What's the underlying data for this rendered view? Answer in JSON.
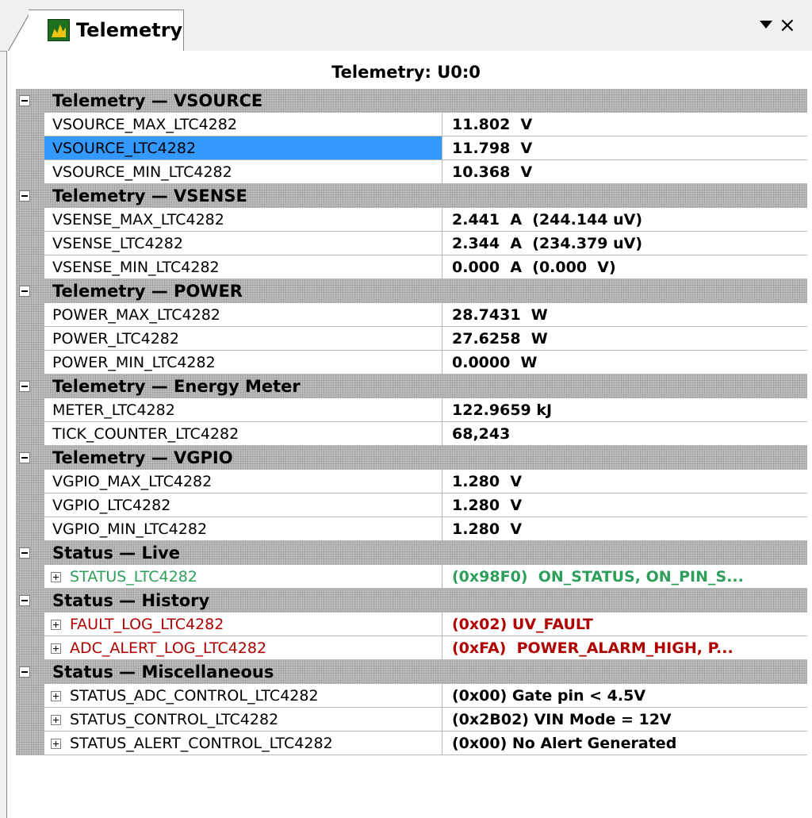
{
  "tab": {
    "label": "Telemetry",
    "close": "×"
  },
  "panel_title": "Telemetry: U0:0",
  "groups": [
    {
      "label": "Telemetry — VSOURCE",
      "rows": [
        {
          "name": "VSOURCE_MAX_LTC4282",
          "value": "11.802  V"
        },
        {
          "name": "VSOURCE_LTC4282",
          "value": "11.798  V",
          "selected": true
        },
        {
          "name": "VSOURCE_MIN_LTC4282",
          "value": "10.368  V"
        }
      ]
    },
    {
      "label": "Telemetry — VSENSE",
      "rows": [
        {
          "name": "VSENSE_MAX_LTC4282",
          "value": "2.441  A  (244.144 uV)"
        },
        {
          "name": "VSENSE_LTC4282",
          "value": "2.344  A  (234.379 uV)"
        },
        {
          "name": "VSENSE_MIN_LTC4282",
          "value": "0.000  A  (0.000  V)"
        }
      ]
    },
    {
      "label": "Telemetry — POWER",
      "rows": [
        {
          "name": "POWER_MAX_LTC4282",
          "value": "28.7431  W"
        },
        {
          "name": "POWER_LTC4282",
          "value": "27.6258  W"
        },
        {
          "name": "POWER_MIN_LTC4282",
          "value": "0.0000  W"
        }
      ]
    },
    {
      "label": "Telemetry — Energy Meter",
      "rows": [
        {
          "name": "METER_LTC4282",
          "value": "122.9659 kJ"
        },
        {
          "name": "TICK_COUNTER_LTC4282",
          "value": "68,243"
        }
      ]
    },
    {
      "label": "Telemetry — VGPIO",
      "rows": [
        {
          "name": "VGPIO_MAX_LTC4282",
          "value": "1.280  V"
        },
        {
          "name": "VGPIO_LTC4282",
          "value": "1.280  V"
        },
        {
          "name": "VGPIO_MIN_LTC4282",
          "value": "1.280  V"
        }
      ]
    },
    {
      "label": "Status — Live",
      "rows": [
        {
          "name": "STATUS_LTC4282",
          "value": "(0x98F0)  ON_STATUS, ON_PIN_S...",
          "expandable": true,
          "color": "green"
        }
      ]
    },
    {
      "label": "Status — History",
      "rows": [
        {
          "name": "FAULT_LOG_LTC4282",
          "value": "(0x02) UV_FAULT",
          "expandable": true,
          "color": "red"
        },
        {
          "name": "ADC_ALERT_LOG_LTC4282",
          "value": "(0xFA)  POWER_ALARM_HIGH, P...",
          "expandable": true,
          "color": "red"
        }
      ]
    },
    {
      "label": "Status — Miscellaneous",
      "rows": [
        {
          "name": "STATUS_ADC_CONTROL_LTC4282",
          "value": "(0x00) Gate pin < 4.5V",
          "expandable": true
        },
        {
          "name": "STATUS_CONTROL_LTC4282",
          "value": "(0x2B02) VIN Mode = 12V",
          "expandable": true
        },
        {
          "name": "STATUS_ALERT_CONTROL_LTC4282",
          "value": "(0x00) No Alert Generated",
          "expandable": true
        }
      ]
    }
  ],
  "colors": {
    "selection": "#3399ff",
    "status_live": "#2e9f5a",
    "status_history": "#b00000"
  }
}
